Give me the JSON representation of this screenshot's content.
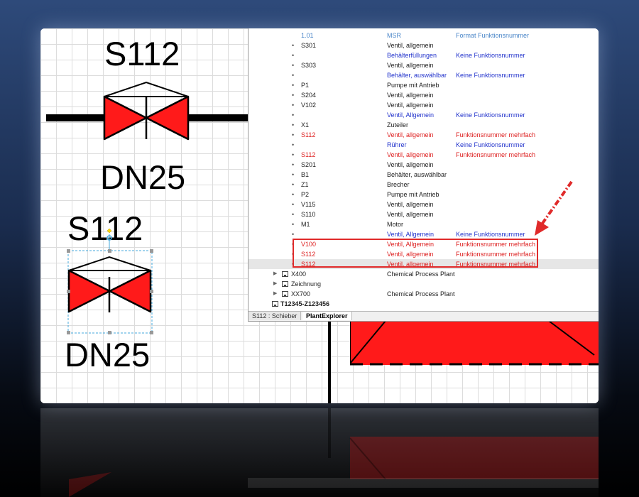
{
  "drawing": {
    "symbol1": {
      "tag": "S112",
      "size": "DN25"
    },
    "symbol2": {
      "tag": "S112",
      "size": "DN25"
    }
  },
  "explorer": {
    "rows": [
      {
        "tag": "1.01",
        "desc": "MSR",
        "status": "Format Funktionsnummer",
        "style": "msr",
        "bullet": ""
      },
      {
        "tag": "S301",
        "desc": "Ventil, allgemein",
        "status": "",
        "style": "normal",
        "bullet": "•"
      },
      {
        "tag": "",
        "desc": "Behälterfüllungen",
        "status": "Keine Funktionsnummer",
        "style": "blue",
        "bullet": "•"
      },
      {
        "tag": "S303",
        "desc": "Ventil, allgemein",
        "status": "",
        "style": "normal",
        "bullet": "•"
      },
      {
        "tag": "",
        "desc": "Behälter, auswählbar",
        "status": "Keine Funktionsnummer",
        "style": "blue",
        "bullet": "•"
      },
      {
        "tag": "P1",
        "desc": "Pumpe mit Antrieb",
        "status": "",
        "style": "normal",
        "bullet": "•"
      },
      {
        "tag": "S204",
        "desc": "Ventil, allgemein",
        "status": "",
        "style": "normal",
        "bullet": "•"
      },
      {
        "tag": "V102",
        "desc": "Ventil, allgemein",
        "status": "",
        "style": "normal",
        "bullet": "•"
      },
      {
        "tag": "",
        "desc": "Ventil, Allgemein",
        "status": "Keine Funktionsnummer",
        "style": "blue",
        "bullet": "•"
      },
      {
        "tag": "X1",
        "desc": "Zuteiler",
        "status": "",
        "style": "normal",
        "bullet": "•"
      },
      {
        "tag": "S112",
        "desc": "Ventil, allgemein",
        "status": "Funktionsnummer mehrfach",
        "style": "red",
        "bullet": "•"
      },
      {
        "tag": "",
        "desc": "Rührer",
        "status": "Keine Funktionsnummer",
        "style": "blue",
        "bullet": "•"
      },
      {
        "tag": "S112",
        "desc": "Ventil, allgemein",
        "status": "Funktionsnummer mehrfach",
        "style": "red",
        "bullet": "•"
      },
      {
        "tag": "S201",
        "desc": "Ventil, allgemein",
        "status": "",
        "style": "normal",
        "bullet": "•"
      },
      {
        "tag": "B1",
        "desc": "Behälter, auswählbar",
        "status": "",
        "style": "normal",
        "bullet": "•"
      },
      {
        "tag": "Z1",
        "desc": "Brecher",
        "status": "",
        "style": "normal",
        "bullet": "•"
      },
      {
        "tag": "P2",
        "desc": "Pumpe mit Antrieb",
        "status": "",
        "style": "normal",
        "bullet": "•"
      },
      {
        "tag": "V115",
        "desc": "Ventil, allgemein",
        "status": "",
        "style": "normal",
        "bullet": "•"
      },
      {
        "tag": "S110",
        "desc": "Ventil, allgemein",
        "status": "",
        "style": "normal",
        "bullet": "•"
      },
      {
        "tag": "M1",
        "desc": "Motor",
        "status": "",
        "style": "normal",
        "bullet": "•"
      },
      {
        "tag": "",
        "desc": "Ventil, Allgemein",
        "status": "Keine Funktionsnummer",
        "style": "blue",
        "bullet": "•"
      },
      {
        "tag": "V100",
        "desc": "Ventil, Allgemein",
        "status": "Funktionsnummer mehrfach",
        "style": "red",
        "bullet": "•"
      },
      {
        "tag": "S112",
        "desc": "Ventil, allgemein",
        "status": "Funktionsnummer mehrfach",
        "style": "red",
        "bullet": "•"
      },
      {
        "tag": "S112",
        "desc": "Ventil, allgemein",
        "status": "Funktionsnummer mehrfach",
        "style": "red",
        "bullet": "•",
        "selected": true
      }
    ],
    "nodes": [
      {
        "name": "X400",
        "desc": "Chemical Process Plant"
      },
      {
        "name": "Zeichnung",
        "desc": ""
      },
      {
        "name": "XX700",
        "desc": "Chemical Process Plant"
      }
    ],
    "root": {
      "name": "T12345-Z123456"
    },
    "tabs": [
      {
        "label": "S112 : Schieber",
        "active": false
      },
      {
        "label": "PlantExplorer",
        "active": true
      }
    ]
  },
  "colors": {
    "valve_fill": "#ff1a1a",
    "error_red": "#dd1f1f",
    "info_blue": "#2233cc",
    "highlight_border": "#e02a2a"
  },
  "icons": {
    "tree_expand": "triangle-right-icon",
    "tree_node": "folder-icon",
    "annotation": "dashed-arrow-icon"
  }
}
